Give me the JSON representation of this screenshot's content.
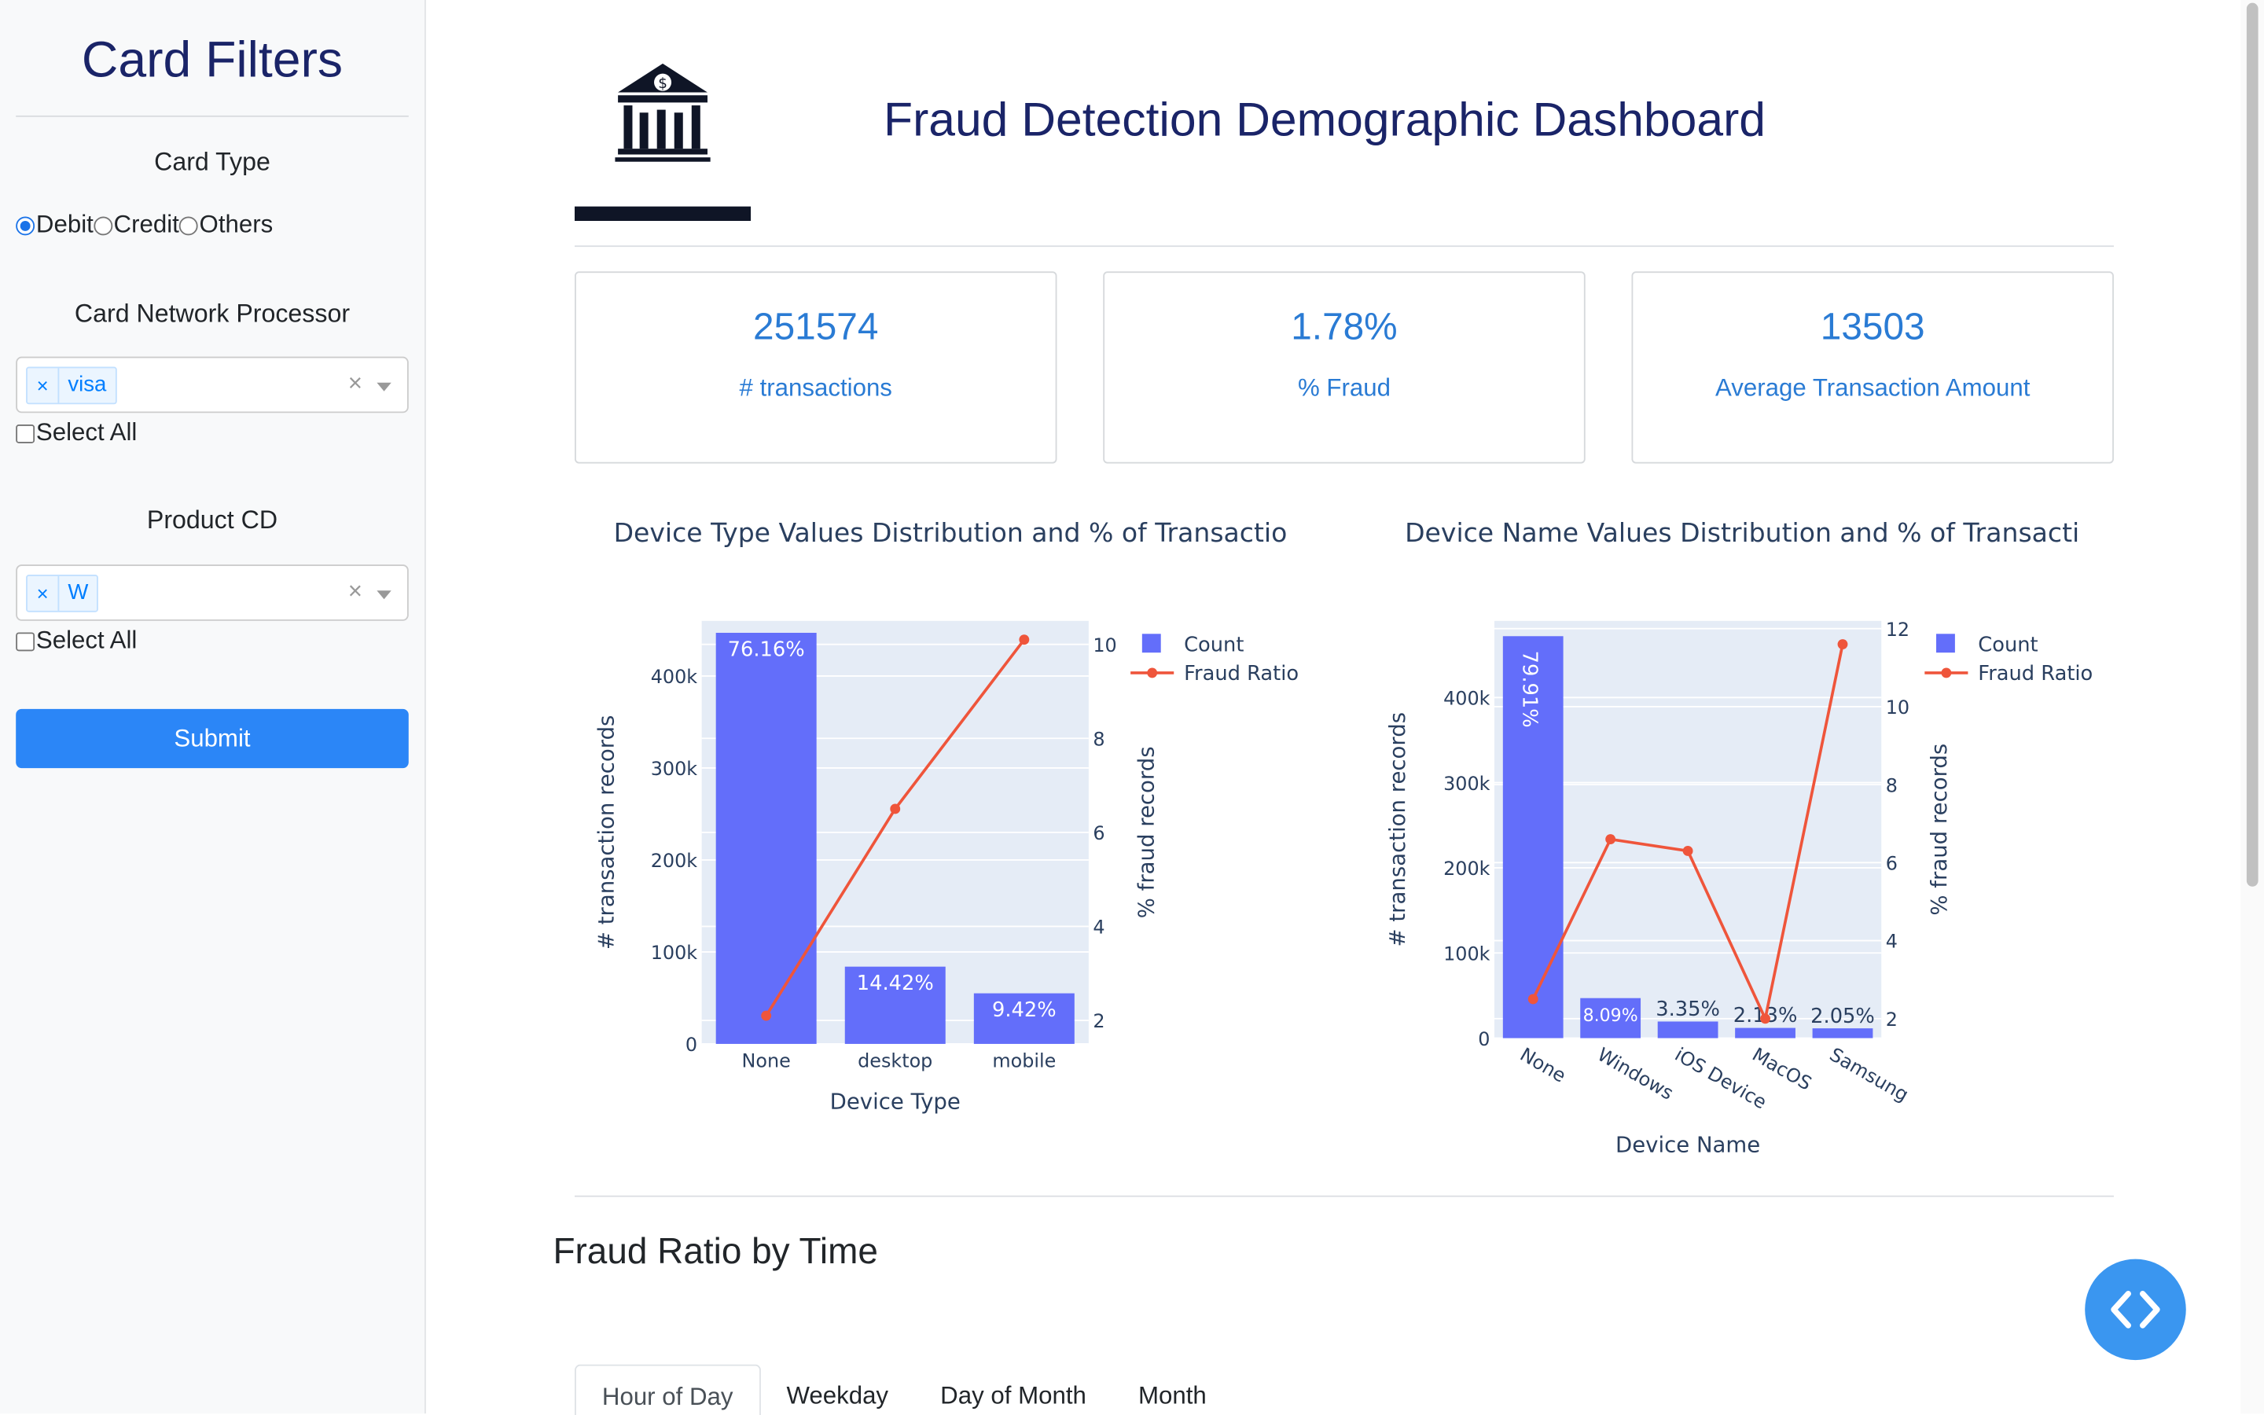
{
  "sidebar": {
    "title": "Card Filters",
    "card_type": {
      "label": "Card Type",
      "options": [
        "Debit",
        "Credit",
        "Others"
      ],
      "selected": "Debit"
    },
    "network": {
      "label": "Card Network Processor",
      "chip": "visa",
      "select_all": "Select All"
    },
    "product": {
      "label": "Product CD",
      "chip": "W",
      "select_all": "Select All"
    },
    "submit_label": "Submit"
  },
  "header": {
    "title": "Fraud Detection Demographic Dashboard",
    "logo_icon": "bank-icon"
  },
  "kpis": [
    {
      "value": "251574",
      "label": "# transactions"
    },
    {
      "value": "1.78%",
      "label": "% Fraud"
    },
    {
      "value": "13503",
      "label": "Average Transaction Amount"
    }
  ],
  "chart_data": [
    {
      "type": "bar",
      "title": "Device Type Values Distribution and % of Transactio",
      "xlabel": "Device Type",
      "ylabel": "# transaction records",
      "y2label": "% fraud records",
      "categories": [
        "None",
        "desktop",
        "mobile"
      ],
      "series": [
        {
          "name": "Count",
          "type": "bar",
          "values": [
            447000,
            84000,
            55000
          ],
          "labels": [
            "76.16%",
            "14.42%",
            "9.42%"
          ],
          "color": "#636efa"
        },
        {
          "name": "Fraud Ratio",
          "type": "line",
          "axis": "y2",
          "values": [
            2.1,
            6.5,
            10.1
          ],
          "color": "#ef553b"
        }
      ],
      "ylim": [
        0,
        460000
      ],
      "y2lim": [
        1.5,
        10.5
      ],
      "yticks": [
        "0",
        "100k",
        "200k",
        "300k",
        "400k"
      ],
      "y2ticks": [
        "2",
        "4",
        "6",
        "8",
        "10"
      ],
      "legend": "top-right"
    },
    {
      "type": "bar",
      "title": "Device Name Values Distribution and % of Transacti",
      "xlabel": "Device Name",
      "ylabel": "# transaction records",
      "y2label": "% fraud records",
      "categories": [
        "None",
        "Windows",
        "iOS Device",
        "MacOS",
        "Samsung"
      ],
      "series": [
        {
          "name": "Count",
          "type": "bar",
          "values": [
            472000,
            47000,
            19500,
            12000,
            11500
          ],
          "labels": [
            "79.91%",
            "8.09%",
            "3.35%",
            "2.13%",
            "2.05%"
          ],
          "color": "#636efa"
        },
        {
          "name": "Fraud Ratio",
          "type": "line",
          "axis": "y2",
          "values": [
            2.5,
            6.6,
            6.3,
            2.0,
            11.6
          ],
          "color": "#ef553b"
        }
      ],
      "ylim": [
        0,
        490000
      ],
      "y2lim": [
        1.5,
        12.2
      ],
      "yticks": [
        "0",
        "100k",
        "200k",
        "300k",
        "400k"
      ],
      "y2ticks": [
        "2",
        "4",
        "6",
        "8",
        "10",
        "12"
      ],
      "legend": "top-right"
    }
  ],
  "time_section": {
    "title": "Fraud Ratio by Time",
    "tabs": [
      "Hour of Day",
      "Weekday",
      "Day of Month",
      "Month"
    ],
    "active_tab": "Hour of Day"
  }
}
